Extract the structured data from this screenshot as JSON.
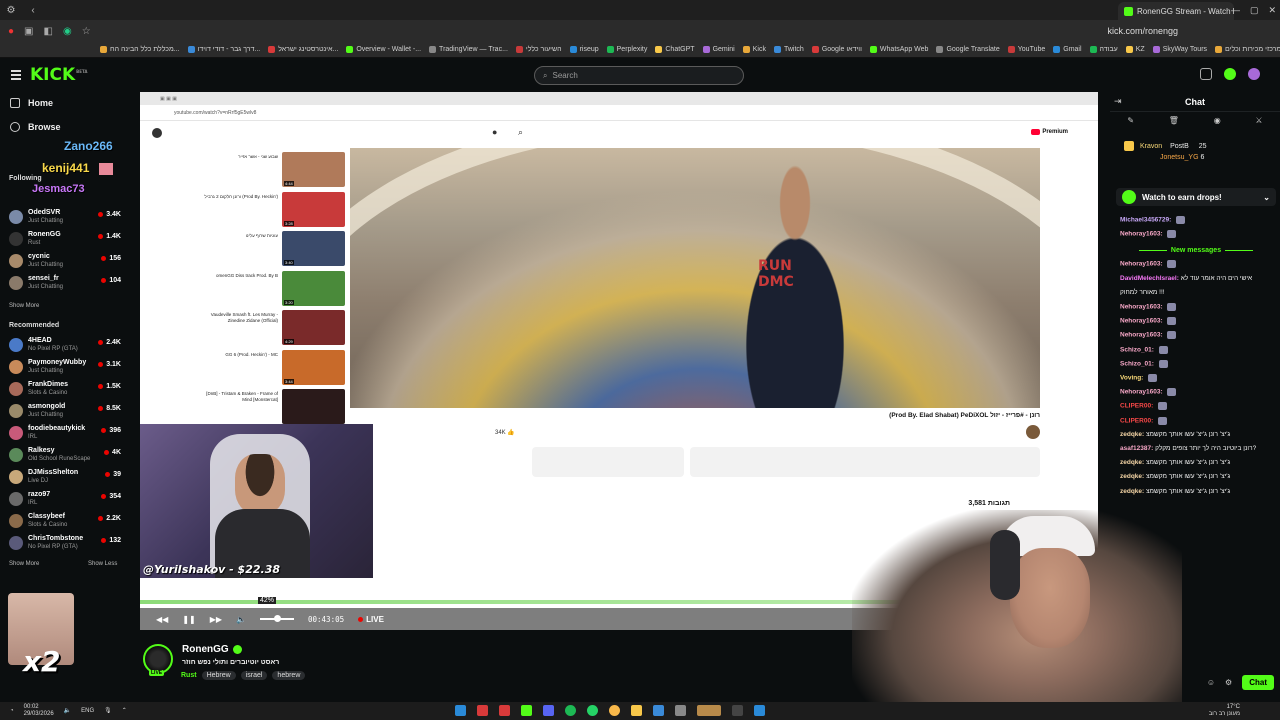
{
  "browser": {
    "active_tab_title": "RonenGG Stream - Watch l",
    "url": "kick.com/ronengg",
    "bookmarks": [
      "מכללת כלל הבינה הח...",
      "דרך גבר - דודי דוידו...",
      "אינטרסטינג ישראל...",
      "Overview - Wallet -...",
      "TradingView — Trac...",
      "השיעור כללי",
      "riseup",
      "Perplexity",
      "ChatGPT",
      "Gemini",
      "Kick",
      "Twitch",
      "Google ווידאו",
      "WhatsApp Web",
      "Google Translate",
      "YouTube",
      "Gmail",
      "עבודה",
      "KZ",
      "SkyWay Tours",
      "מרכזי מכירות וכלים",
      "משאבים"
    ]
  },
  "kick_header": {
    "logo": "KICK",
    "logo_badge": "BETA",
    "search_placeholder": "Search"
  },
  "sidebar": {
    "nav": [
      {
        "label": "Home",
        "icon": "home-icon"
      },
      {
        "label": "Browse",
        "icon": "compass-icon"
      },
      {
        "label": "Following",
        "icon": "heart-icon"
      }
    ],
    "following_title": "Following",
    "following": [
      {
        "name": "OdedSVR",
        "category": "Just Chatting",
        "viewers": "3.4K",
        "color": "#7a8aa8"
      },
      {
        "name": "RonenGG",
        "category": "Rust",
        "viewers": "1.4K",
        "color": "#333"
      },
      {
        "name": "cycnic",
        "category": "Just Chatting",
        "viewers": "156",
        "color": "#a88a6a"
      },
      {
        "name": "sensei_fr",
        "category": "Just Chatting",
        "viewers": "104",
        "color": "#8a7a6a"
      }
    ],
    "show_more": "Show More",
    "recommended_title": "Recommended",
    "recommended": [
      {
        "name": "4HEAD",
        "category": "No Pixel RP (GTA)",
        "viewers": "2.4K",
        "color": "#4a7ac8"
      },
      {
        "name": "PaymoneyWubby",
        "category": "Just Chatting",
        "viewers": "3.1K",
        "color": "#c88a5a"
      },
      {
        "name": "FrankDimes",
        "category": "Slots & Casino",
        "viewers": "1.5K",
        "color": "#a86a5a"
      },
      {
        "name": "asmongold",
        "category": "Just Chatting",
        "viewers": "8.5K",
        "color": "#9a8a6a"
      },
      {
        "name": "foodiebeautykick",
        "category": "IRL",
        "viewers": "396",
        "color": "#c85a7a"
      },
      {
        "name": "Ralkesy",
        "category": "Old School RuneScape",
        "viewers": "4K",
        "color": "#5a8a5a"
      },
      {
        "name": "DJMissShelton",
        "category": "Live DJ",
        "viewers": "39",
        "color": "#c8a87a"
      },
      {
        "name": "razo97",
        "category": "IRL",
        "viewers": "354",
        "color": "#6a6a6a"
      },
      {
        "name": "Classybeef",
        "category": "Slots & Casino",
        "viewers": "2.2K",
        "color": "#8a6a4a"
      },
      {
        "name": "ChrisTombstone",
        "category": "No Pixel RP (GTA)",
        "viewers": "132",
        "color": "#5a5a7a"
      }
    ],
    "show_more_2": "Show More",
    "show_less": "Show Less"
  },
  "overlay_alerts": [
    {
      "user": "Zano266",
      "text": ""
    },
    {
      "user": "kenij441",
      "text": ""
    },
    {
      "user": "Jesmac73",
      "text": ""
    }
  ],
  "stream": {
    "inner_url": "youtube.com/watch?v=nRrf5gE5wlv8",
    "video_title": "(Prod By. Elad Shabat) PeDiXOL רונן - #פרייז - יזול",
    "premium": "Premium",
    "comments_count": "3,581 תגובות",
    "donation": "@YuriIshakov - $22.38",
    "volume": "42%",
    "time": "00:43:05",
    "live": "LIVE",
    "recs": [
      {
        "text": "שבוע שני - אשר אזייר",
        "dur": "4:44",
        "color": "#b07a5a"
      },
      {
        "text": "ורונן חלקום 2 גרביל (Prod By. Heckin')",
        "dur": "3:28",
        "color": "#c83a3a"
      },
      {
        "text": "עוגיות שרוף עלינו",
        "dur": "3:40",
        "color": "#3a4a6a"
      },
      {
        "text": "omenGG Diss track Prod. By B",
        "dur": "3:20",
        "color": "#4a8a3a"
      },
      {
        "text": "Vaudeville Smash ft. Les Murray - Zinedine Zidane (Official)",
        "dur": "4:29",
        "color": "#7a2a2a"
      },
      {
        "text": "GG 6 (Prod. Heckin') - MC",
        "dur": "3:44",
        "color": "#c86a2a"
      },
      {
        "text": "[DnB] - Tristam & Braken - Frame of Mind [Monstercat]",
        "dur": "",
        "color": "#2a1a1a"
      }
    ]
  },
  "streamer": {
    "name": "RonenGG",
    "title": "ראסט יוטיוברים ותולי נפש חוזר",
    "game": "Rust",
    "tags": [
      "Hebrew",
      "israel",
      "hebrew"
    ],
    "live_badge": "LIVE"
  },
  "chat": {
    "title": "Chat",
    "pinned": [
      {
        "user": "Kravon",
        "count": ""
      },
      {
        "user": "PostB",
        "count": "25"
      },
      {
        "user": "Jonetsu_YG",
        "count": "6"
      }
    ],
    "earn_drops": "Watch to earn drops!",
    "new_messages": "New messages",
    "messages": [
      {
        "user": "Michael3456729:",
        "text": "",
        "color": "#c8a8f8"
      },
      {
        "user": "Nehoray1603:",
        "text": "",
        "color": "#f8a8c8"
      },
      {
        "user": "Nehoray1603:",
        "text": "",
        "color": "#f8a8c8"
      },
      {
        "user": "DavidMelechIsrael:",
        "text": "אישי הים היה אומר עוד לא",
        "color": "#f878f8"
      },
      {
        "user": "",
        "text": "מאוחר למחוק !!!",
        "color": "#eee"
      },
      {
        "user": "Nehoray1603:",
        "text": "",
        "color": "#f8a8c8"
      },
      {
        "user": "Nehoray1603:",
        "text": "",
        "color": "#f8a8c8"
      },
      {
        "user": "Nehoray1603:",
        "text": "",
        "color": "#f8a8c8"
      },
      {
        "user": "Schizo_01:",
        "text": "",
        "color": "#f8a8c8"
      },
      {
        "user": "Schizo_01:",
        "text": "",
        "color": "#f8a8c8"
      },
      {
        "user": "Voving:",
        "text": "",
        "color": "#f8d878"
      },
      {
        "user": "Nehoray1603:",
        "text": "",
        "color": "#f8a8c8"
      },
      {
        "user": "CLIPER00:",
        "text": "",
        "color": "#f84848"
      },
      {
        "user": "CLIPER00:",
        "text": "",
        "color": "#f84848"
      },
      {
        "user": "zedqke:",
        "text": "ג'יצ' רונן ג'יצ' עשו אותך מקשמצ",
        "color": "#f8d8a8"
      },
      {
        "user": "asaf12387:",
        "text": "רונן ביוטיוב היה לך יותר צופים מקלק?",
        "color": "#f8a8c8"
      },
      {
        "user": "zedqke:",
        "text": "ג'יצ' רונן ג'יצ' עשו אותך מקשמצ",
        "color": "#f8d8a8"
      },
      {
        "user": "zedqke:",
        "text": "ג'יצ' רונן ג'יצ' עשו אותך מקשמצ",
        "color": "#f8d8a8"
      },
      {
        "user": "zedqke:",
        "text": "ג'יצ' רונן ג'יצ' עשו אותך מקשמצ",
        "color": "#f8d8a8"
      }
    ],
    "send_label": "Chat"
  },
  "taskbar": {
    "time": "00:02",
    "date": "29/03/2026",
    "lang": "ENG",
    "weather": "17°C",
    "weather_note": "מעונן רב רוב"
  },
  "colors": {
    "kick_green": "#53fc18",
    "bg": "#0b0e0f",
    "live_red": "#eb0400"
  }
}
